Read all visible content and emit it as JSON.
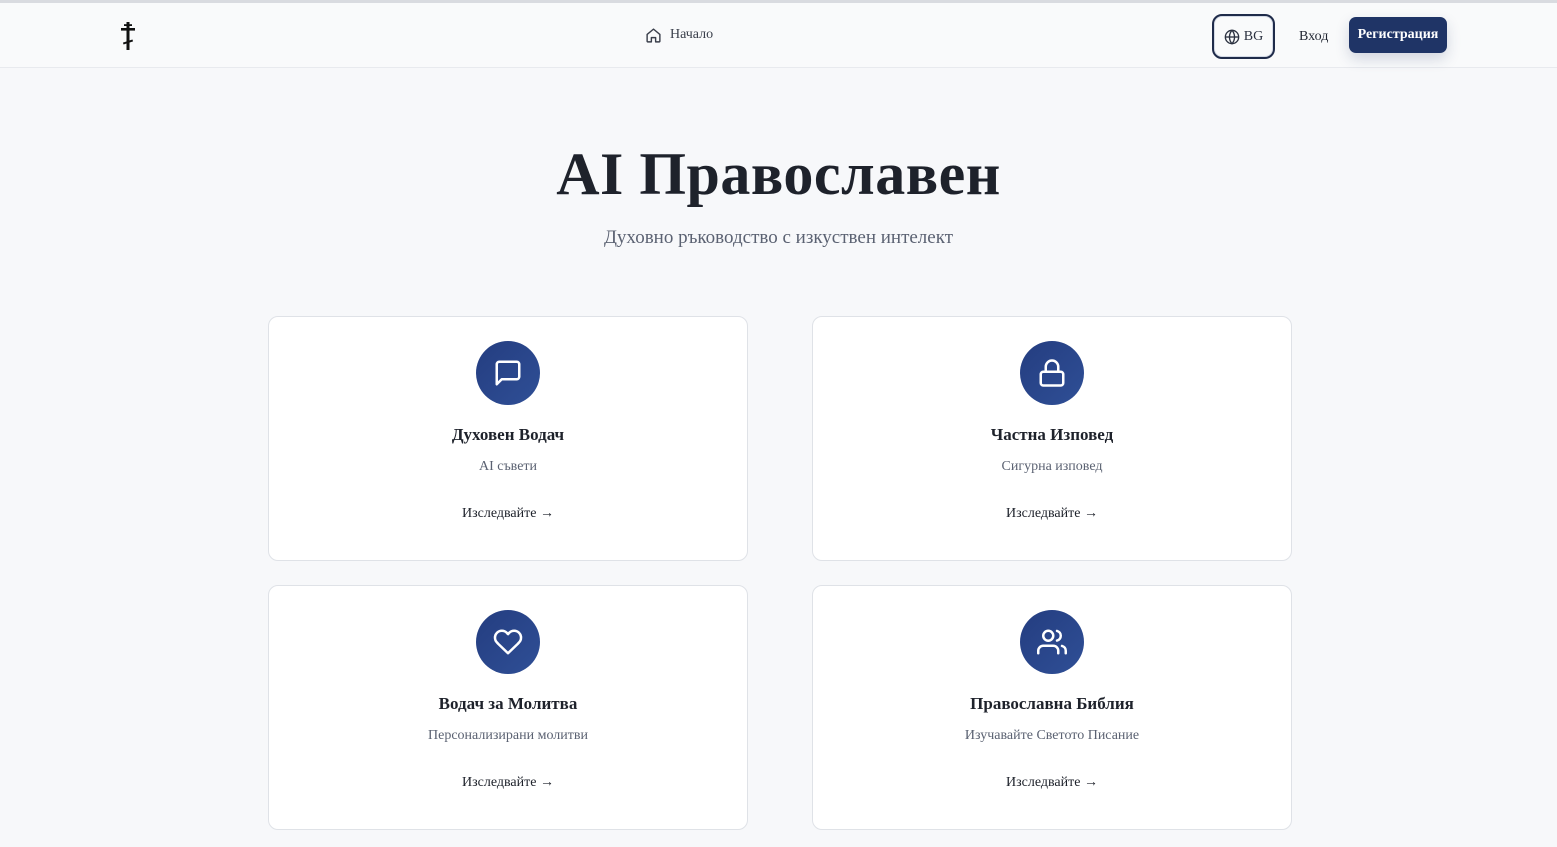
{
  "header": {
    "logo_icon": "orthodox-cross-icon",
    "nav_home_label": "Начало",
    "nav_home_icon": "home-icon",
    "lang_label": "BG",
    "lang_icon": "globe-icon",
    "login_label": "Вход",
    "register_label": "Регистрация"
  },
  "hero": {
    "title": "AI Православен",
    "subtitle": "Духовно ръководство с изкуствен интелект"
  },
  "cards": [
    {
      "icon": "message-square-icon",
      "title": "Духовен Водач",
      "description": "AI съвети",
      "link": "Изследвайте →"
    },
    {
      "icon": "lock-icon",
      "title": "Частна Изповед",
      "description": "Сигурна изповед",
      "link": "Изследвайте →"
    },
    {
      "icon": "heart-icon",
      "title": "Водач за Молитва",
      "description": "Персонализирани молитви",
      "link": "Изследвайте →"
    },
    {
      "icon": "users-icon",
      "title": "Православна Библия",
      "description": "Изучавайте Светото Писание",
      "link": "Изследвайте →"
    }
  ],
  "colors": {
    "accent": "#1f3466",
    "icon_gradient_start": "#243d80",
    "icon_gradient_end": "#2f4f96",
    "background": "#f7f8fa"
  }
}
